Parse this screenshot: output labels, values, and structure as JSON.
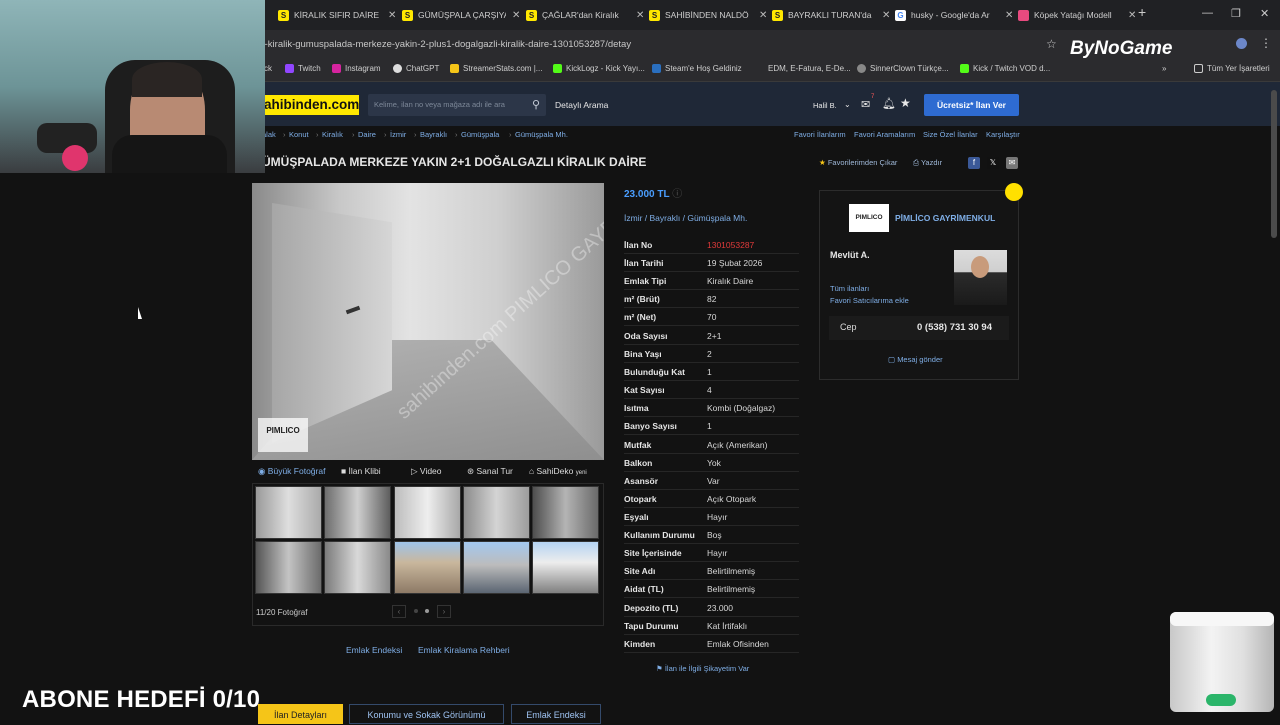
{
  "browser": {
    "tabs": [
      {
        "label": "KİRALIK SIFIR DAİRE",
        "fav_color": "#ffe800",
        "fav_text": "S"
      },
      {
        "label": "GÜMÜŞPALA ÇARŞIYA",
        "fav_color": "#ffe800",
        "fav_text": "S"
      },
      {
        "label": "ÇAĞLAR'dan Kiralık",
        "fav_color": "#ffe800",
        "fav_text": "S"
      },
      {
        "label": "SAHİBİNDEN NALDÖ",
        "fav_color": "#ffe800",
        "fav_text": "S"
      },
      {
        "label": "BAYRAKLI TURAN'da",
        "fav_color": "#ffe800",
        "fav_text": "S"
      },
      {
        "label": "husky - Google'da Ar",
        "fav_color": "#ffffff",
        "fav_text": "G"
      },
      {
        "label": "Köpek Yatağı Modell",
        "fav_color": "#e84a7f",
        "fav_text": ""
      }
    ],
    "url": "t-kiralik-gumuspalada-merkeze-yakin-2-plus1-dogalgazli-kiralik-daire-1301053287/detay",
    "bookmarks": [
      "ck",
      "Twitch",
      "Instagram",
      "ChatGPT",
      "StreamerStats.com |...",
      "KickLogz - Kick Yayı...",
      "Steam'e Hoş Geldiniz",
      "EDM, E-Fatura, E-De...",
      "SinnerClown Türkçe...",
      "Kick / Twitch VOD d..."
    ],
    "bookmarks_folder": "Tüm Yer İşaretleri",
    "overlay_logo": "ByNoGame"
  },
  "site": {
    "logo": "ahibinden.com",
    "search_placeholder": "Kelime, ilan no veya mağaza adı ile ara",
    "detailed_search": "Detaylı Arama",
    "user": "Halil B.",
    "notif_count": "7",
    "post_button": "Ücretsiz* İlan Ver"
  },
  "breadcrumb": [
    "alak",
    "Konut",
    "Kiralık",
    "Daire",
    "İzmir",
    "Bayraklı",
    "Gümüşpala",
    "Gümüşpala Mh."
  ],
  "top_links": [
    "Favori İlanlarım",
    "Favori Aramalarım",
    "Size Özel İlanlar",
    "Karşılaştır"
  ],
  "listing": {
    "title": "ÜMÜŞPALADA MERKEZE YAKIN 2+1 DOĞALGAZLI KİRALIK DAİRE",
    "fav_action": "Favorilerimden Çıkar",
    "print": "Yazdır",
    "photo_watermark": "sahibinden.com PIMLICO GAYRIMENKUL",
    "photo_brand": "PIMLICO",
    "photo_tabs": [
      "Büyük Fotoğraf",
      "İlan Klibi",
      "Video",
      "Sanal Tur",
      "SahiDeko"
    ],
    "photo_tab_badge": "yeni",
    "photo_count": "11/20 Fotoğraf",
    "bottom_links": [
      "Emlak Endeksi",
      "Emlak Kiralama Rehberi"
    ],
    "price": "23.000 TL",
    "location": [
      "İzmir",
      "Bayraklı",
      "Gümüşpala Mh."
    ],
    "details": [
      {
        "k": "İlan No",
        "v": "1301053287",
        "red": true
      },
      {
        "k": "İlan Tarihi",
        "v": "19 Şubat 2026"
      },
      {
        "k": "Emlak Tipi",
        "v": "Kiralık Daire"
      },
      {
        "k": "m² (Brüt)",
        "v": "82"
      },
      {
        "k": "m² (Net)",
        "v": "70"
      },
      {
        "k": "Oda Sayısı",
        "v": "2+1"
      },
      {
        "k": "Bina Yaşı",
        "v": "2"
      },
      {
        "k": "Bulunduğu Kat",
        "v": "1"
      },
      {
        "k": "Kat Sayısı",
        "v": "4"
      },
      {
        "k": "Isıtma",
        "v": "Kombi (Doğalgaz)"
      },
      {
        "k": "Banyo Sayısı",
        "v": "1"
      },
      {
        "k": "Mutfak",
        "v": "Açık (Amerikan)"
      },
      {
        "k": "Balkon",
        "v": "Yok"
      },
      {
        "k": "Asansör",
        "v": "Var"
      },
      {
        "k": "Otopark",
        "v": "Açık Otopark"
      },
      {
        "k": "Eşyalı",
        "v": "Hayır"
      },
      {
        "k": "Kullanım Durumu",
        "v": "Boş"
      },
      {
        "k": "Site İçerisinde",
        "v": "Hayır"
      },
      {
        "k": "Site Adı",
        "v": "Belirtilmemiş"
      },
      {
        "k": "Aidat (TL)",
        "v": "Belirtilmemiş"
      },
      {
        "k": "Depozito (TL)",
        "v": "23.000"
      },
      {
        "k": "Tapu Durumu",
        "v": "Kat İrtifaklı"
      },
      {
        "k": "Kimden",
        "v": "Emlak Ofisinden"
      }
    ],
    "complaint": "İlan ile İlgili Şikayetim Var"
  },
  "seller": {
    "agency_logo": "PIMLICO",
    "agency": "PİMLİCO GAYRİMENKUL",
    "name": "Mevlüt A.",
    "all_listings": "Tüm ilanları",
    "add_fav_seller": "Favori Satıcılarıma ekle",
    "phone_label": "Cep",
    "phone": "0 (538) 731 30 94",
    "message": "Mesaj gönder"
  },
  "bottom_tabs": [
    "İlan Detayları",
    "Konumu ve Sokak Görünümü",
    "Emlak Endeksi"
  ],
  "stream_overlay": {
    "goal": "ABONE HEDEFİ 0/10"
  }
}
